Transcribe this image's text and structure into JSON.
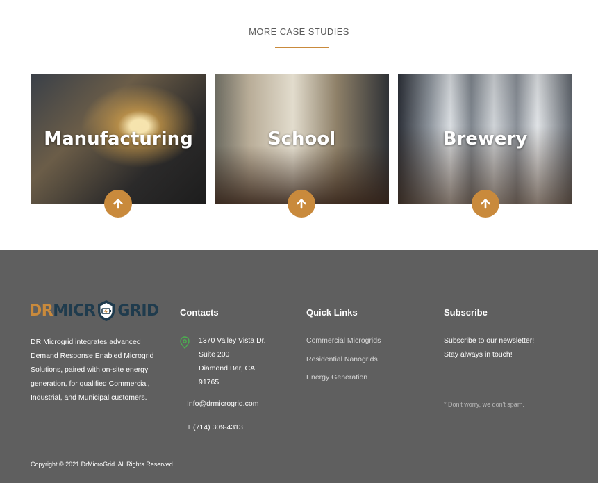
{
  "section": {
    "title": "MORE CASE STUDIES"
  },
  "cards": [
    {
      "label": "Manufacturing"
    },
    {
      "label": "School"
    },
    {
      "label": "Brewery"
    }
  ],
  "footer": {
    "logo": {
      "dr": "DR",
      "micro": "MICR",
      "grid": "GRID"
    },
    "about": "DR Microgrid integrates advanced Demand Response Enabled Microgrid Solutions, paired with on-site energy generation, for qualified Commercial, Industrial, and Municipal customers.",
    "contacts": {
      "heading": "Contacts",
      "address_line1": "1370 Valley Vista Dr.",
      "address_line2": "Suite 200",
      "address_line3": "Diamond Bar, CA",
      "address_line4": "91765",
      "email": "Info@drmicrogrid.com",
      "phone": "+ (714) 309-4313"
    },
    "quick_links": {
      "heading": "Quick Links",
      "items": [
        "Commercial Microgrids",
        "Residential Nanogrids",
        "Energy Generation"
      ]
    },
    "subscribe": {
      "heading": "Subscribe",
      "line1": "Subscribe to our newsletter!",
      "line2": "Stay always in touch!",
      "note": "* Don't worry, we don't spam."
    },
    "copyright": "Copyright © 2021 DrMicroGrid. All Rights Reserved"
  },
  "colors": {
    "accent": "#c98a3c",
    "footer_bg": "#5f5f5f",
    "logo_dark": "#1f3b4d"
  }
}
